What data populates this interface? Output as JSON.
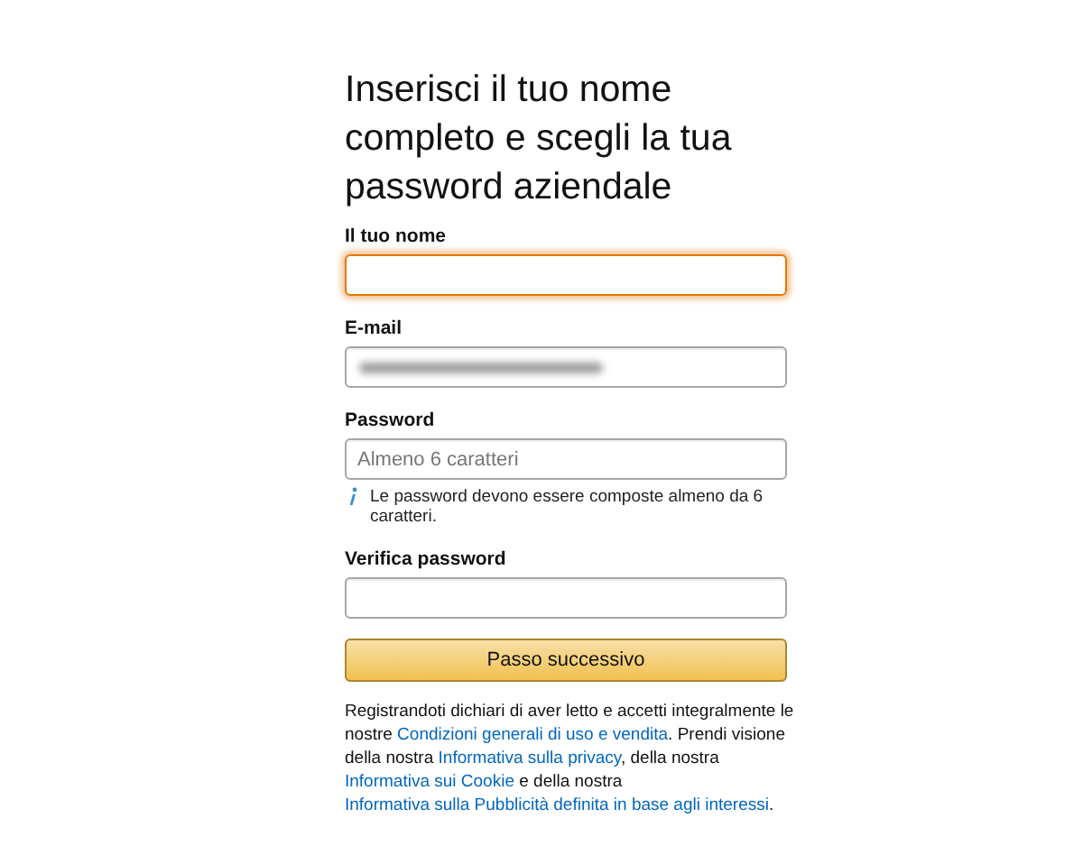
{
  "heading": "Inserisci il tuo nome completo e scegli la tua password aziendale",
  "fields": [
    {
      "label": "Il tuo nome",
      "focused": true
    },
    {
      "label": "E-mail",
      "focused": false,
      "redacted": true
    },
    {
      "label": "Password",
      "focused": false,
      "placeholder": "Almeno 6 caratteri",
      "hint": "Le password devono essere composte almeno da 6 caratteri."
    },
    {
      "label": "Verifica password",
      "focused": false
    }
  ],
  "button": "Passo successivo",
  "legal": [
    {
      "kind": "text",
      "text": "Registrandoti dichiari di aver letto e accetti integralmente le nostre "
    },
    {
      "kind": "link",
      "text": "Condizioni generali di uso e vendita"
    },
    {
      "kind": "text",
      "text": ". Prendi visione della nostra "
    },
    {
      "kind": "link",
      "text": "Informativa sulla privacy"
    },
    {
      "kind": "text",
      "text": ", della nostra "
    },
    {
      "kind": "link",
      "text": "Informativa sui Cookie"
    },
    {
      "kind": "text",
      "text": " e della nostra "
    },
    {
      "kind": "link",
      "text": "Informativa sulla Pubblicità definita in base agli interessi"
    },
    {
      "kind": "text",
      "text": "."
    }
  ]
}
